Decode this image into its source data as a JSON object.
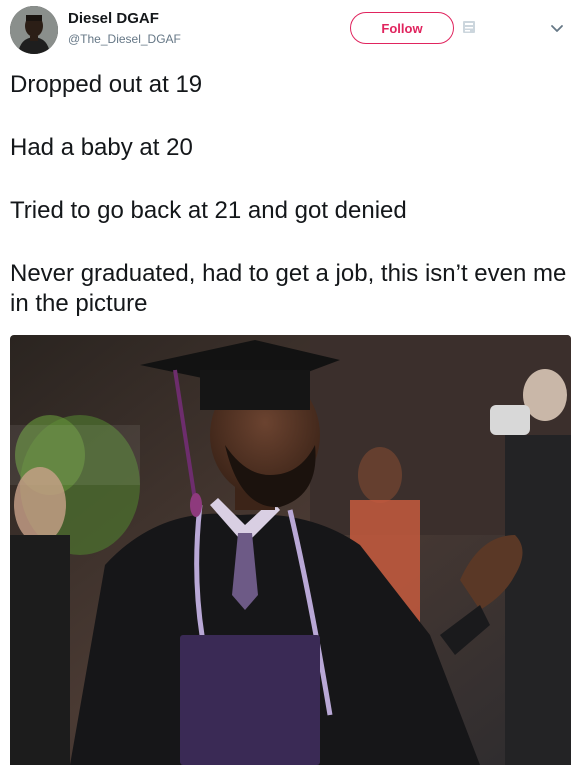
{
  "user": {
    "display_name": "Diesel DGAF",
    "handle": "@The_Diesel_DGAF",
    "avatar_icon": "avatar-photo"
  },
  "actions": {
    "follow_label": "Follow",
    "follow_color": "#e0245e",
    "more_icon": "chevron-down-icon"
  },
  "tweet": {
    "lines": [
      "Dropped out at 19",
      "Had a baby at 20",
      "Tried to go back at 21 and got denied",
      "Never graduated, had to get a job, this isn’t even me in the picture"
    ]
  },
  "media": {
    "kind": "photo"
  }
}
